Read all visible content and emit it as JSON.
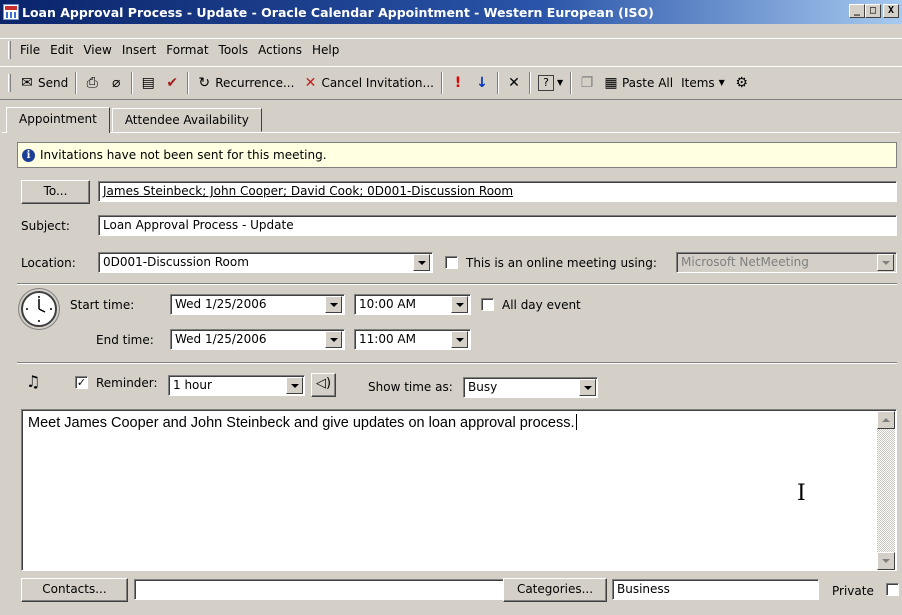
{
  "window": {
    "title": "Loan Approval Process - Update - Oracle Calendar Appointment  - Western European (ISO)",
    "buttons": [
      "_",
      "□",
      "X"
    ]
  },
  "menu": [
    "File",
    "Edit",
    "View",
    "Insert",
    "Format",
    "Tools",
    "Actions",
    "Help"
  ],
  "toolbar": {
    "send_label": "Send",
    "recurrence_label": "Recurrence...",
    "cancel_invitation_label": "Cancel Invitation...",
    "paste_all_label": "Paste All",
    "items_label": "Items"
  },
  "tabs": [
    "Appointment",
    "Attendee Availability"
  ],
  "info_message": "Invitations have not been sent for this meeting.",
  "form": {
    "to_button": "To...",
    "to_value": "James Steinbeck; John Cooper; David Cook; 0D001-Discussion Room",
    "subject_label": "Subject:",
    "subject_value": "Loan Approval Process - Update",
    "location_label": "Location:",
    "location_value": "0D001-Discussion Room",
    "online_meeting_label": "This is an online meeting using:",
    "online_meeting_value": "Microsoft NetMeeting",
    "online_meeting_checked": false,
    "start_time_label": "Start time:",
    "start_date": "Wed 1/25/2006",
    "start_time": "10:00 AM",
    "all_day_label": "All day event",
    "all_day_checked": false,
    "end_time_label": "End time:",
    "end_date": "Wed 1/25/2006",
    "end_time": "11:00 AM",
    "reminder_label": "Reminder:",
    "reminder_checked": true,
    "reminder_value": "1 hour",
    "show_time_as_label": "Show time as:",
    "show_time_as_value": "Busy",
    "notes": "Meet James Cooper  and John Steinbeck and give updates on loan approval process."
  },
  "footer": {
    "contacts_button": "Contacts...",
    "contacts_value": "",
    "categories_button": "Categories...",
    "categories_value": "Business",
    "private_label": "Private",
    "private_checked": false
  },
  "colors": {
    "title_bar": "#0a246a",
    "info_bar_bg": "#ffffe1",
    "window_bg": "#d4d0c8"
  }
}
